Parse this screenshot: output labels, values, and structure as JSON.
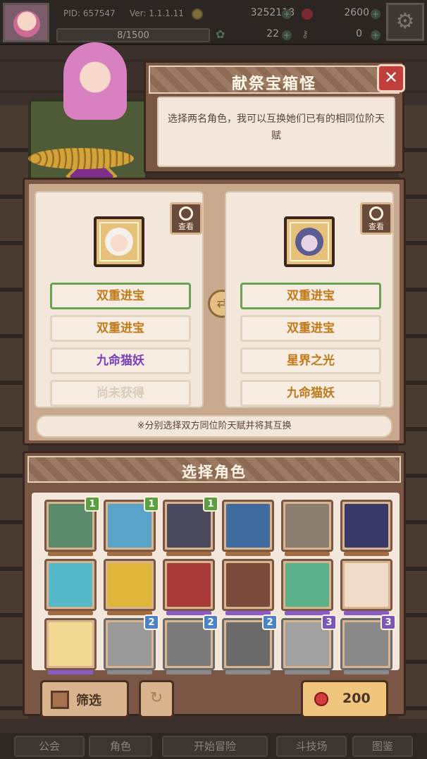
{
  "topbar": {
    "pid": "PID: 657547",
    "version": "Ver: 1.1.1.11",
    "xp": "8/1500",
    "gold": "3252118",
    "gems": "2600",
    "clover": "22",
    "keys": "0"
  },
  "event": {
    "title": "献祭宝箱怪",
    "close": "✕",
    "description": "选择两名角色，我可以互换她们已有的相同位阶天赋"
  },
  "swap": {
    "view_label": "查看",
    "left_talents": [
      "双重进宝",
      "双重进宝",
      "九命猫妖",
      "尚未获得"
    ],
    "right_talents": [
      "双重进宝",
      "双重进宝",
      "星界之光",
      "九命猫妖"
    ],
    "note": "※分别选择双方同位阶天赋并将其互换"
  },
  "char_select": {
    "title": "选择角色",
    "filter_label": "筛选",
    "cost": "200",
    "badges": [
      "1",
      "1",
      "1",
      "2",
      "2",
      "2",
      "3",
      "3"
    ]
  },
  "nav": {
    "items": [
      "公会",
      "角色",
      "开始冒险",
      "斗技场",
      "图鉴"
    ]
  },
  "colors": {
    "talent_orange": "#c07a1a",
    "talent_purple": "#7a3fbe",
    "selected_border": "#6aa34f",
    "panel_brown": "#7a5644"
  }
}
